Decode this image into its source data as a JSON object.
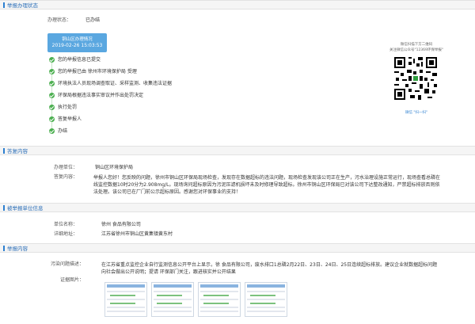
{
  "sections": {
    "status_title": "举报办理状态",
    "reply_title": "答复内容",
    "unit_title": "被举报单位信息",
    "content_title": "举报内容"
  },
  "status": {
    "label": "办理状态：",
    "value": "已办结",
    "time_title": "铜山区办理情况",
    "time_value": "2019-02-26 15:03:53",
    "steps": [
      "您的举报信息已提交",
      "您的举报已由 徐州市环境保护局 受理",
      "环境执法人员现场调查取证、采样监测、收集违法证据",
      "环保局根据违法事实审议并作出处罚决定",
      "执行处罚",
      "答复举报人",
      "办结"
    ]
  },
  "qr": {
    "caption_top_1": "微信扫描下方二维码",
    "caption_top_2": "关注微信公众号\"12369环保举报\"",
    "caption_bottom": "微信 \"扫一扫\""
  },
  "reply": {
    "unit_label": "办理单位：",
    "unit_value": "铜山区环境保护局",
    "content_label": "答复内容：",
    "content_value": "举报人您好！您反映的问题，徐州市铜山区环保局现场检查，发现存在数据超标的违法问题，现场检查发现该公司正在生产，污水治理设施正常运行，现场查看总磷在线监控数据10时20分为2.908mg/L。现场询问超标原因为污泥压滤机损坏未及时修理导致超标。徐州市铜山区环保局已对该公司下达整改通知，严禁超标排放否则依法处理。该公司已在厂门前公示超标原因。感谢您对环保事业的支持！"
  },
  "unit": {
    "name_label": "单位名称：",
    "name_value": "徐州    食品有限公司",
    "address_label": "详细地址：",
    "address_value": "江苏省徐州市铜山区黄集镇黄东村"
  },
  "report": {
    "desc_label": "污染问题描述：",
    "desc_value": "在江苏省重点监控企业自行监测信息公开平台上显示，徐    食品有限公司，废水排口1总磷2月22日、23日、24日、25日连续超标排放。建议企业就数据超标问题向社会做出公开说明；提请 环保部门关注，跟进核实并公开结果",
    "images_label": "证据图片："
  },
  "colors": {
    "accent": "#2c7fd0",
    "time_box": "#5aa7e0",
    "step_done": "#4caf50"
  }
}
